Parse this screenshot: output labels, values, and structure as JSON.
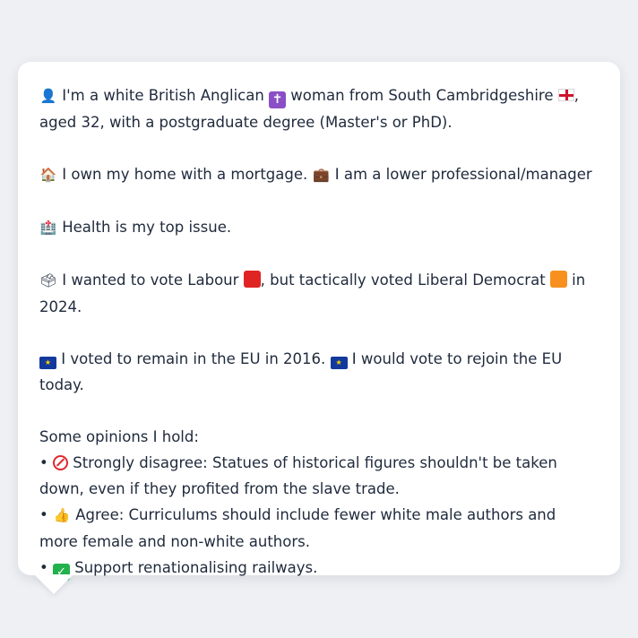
{
  "profile": {
    "p1": {
      "icon": "bust-in-silhouette-icon",
      "text_a": "I'm a white British Anglican",
      "icon2": "latin-cross-icon",
      "text_b": "woman from South Cambridgeshire",
      "icon3": "england-flag-icon",
      "text_c": ", aged 32, with a postgraduate degree (Master's or PhD)."
    },
    "p2": {
      "icon": "house-icon",
      "text_a": "I own my home with a mortgage.",
      "icon2": "briefcase-icon",
      "text_b": "I am a lower professional/manager"
    },
    "p3": {
      "icon": "hospital-icon",
      "text_a": "Health is my top issue."
    },
    "p4": {
      "icon": "ballot-box-icon",
      "text_a": "I wanted to vote Labour",
      "text_b": ", but tactically voted Liberal Democrat",
      "text_c": "in 2024.",
      "labour_color": "#e02424",
      "libdem_color": "#f7901e"
    },
    "p5": {
      "icon": "eu-flag-icon",
      "text_a": "I voted to remain in the EU in 2016.",
      "text_b": "I would vote to rejoin the EU today."
    },
    "opinions": {
      "heading": "Some opinions I hold:",
      "items": [
        {
          "icon": "no-entry-icon",
          "text": "Strongly disagree: Statues of historical figures shouldn't be taken down, even if they profited from the slave trade."
        },
        {
          "icon": "thumbs-up-icon",
          "text": "Agree: Curriculums should include fewer white male authors and more female and non-white authors."
        },
        {
          "icon": "check-mark-icon",
          "text": "Support renationalising railways."
        }
      ]
    }
  }
}
